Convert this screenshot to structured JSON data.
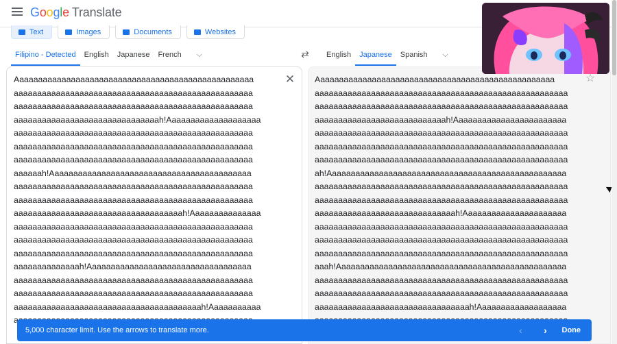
{
  "app": {
    "brand_letters": [
      "G",
      "o",
      "o",
      "g",
      "l",
      "e"
    ],
    "brand_suffix": "Translate"
  },
  "modes": [
    {
      "label": "Text",
      "icon": "translate-icon",
      "active": true
    },
    {
      "label": "Images",
      "icon": "image-icon",
      "active": false
    },
    {
      "label": "Documents",
      "icon": "document-icon",
      "active": false
    },
    {
      "label": "Websites",
      "icon": "website-icon",
      "active": false
    }
  ],
  "source_langs": [
    {
      "label": "Filipino - Detected",
      "active": true
    },
    {
      "label": "English",
      "active": false
    },
    {
      "label": "Japanese",
      "active": false
    },
    {
      "label": "French",
      "active": false
    }
  ],
  "target_langs": [
    {
      "label": "English",
      "active": false
    },
    {
      "label": "Japanese",
      "active": true
    },
    {
      "label": "Spanish",
      "active": false
    }
  ],
  "source_text": "Aaaaaaaaaaaaaaaaaaaaaaaaaaaaaaaaaaaaaaaaaaaaaaaaaaa\naaaaaaaaaaaaaaaaaaaaaaaaaaaaaaaaaaaaaaaaaaaaaaaaaaa\naaaaaaaaaaaaaaaaaaaaaaaaaaaaaaaaaaaaaaaaaaaaaaaaaaa\naaaaaaaaaaaaaaaaaaaaaaaaaaaaaaah!Aaaaaaaaaaaaaaaaaaaa\naaaaaaaaaaaaaaaaaaaaaaaaaaaaaaaaaaaaaaaaaaaaaaaaaaa\naaaaaaaaaaaaaaaaaaaaaaaaaaaaaaaaaaaaaaaaaaaaaaaaaaa\naaaaaaaaaaaaaaaaaaaaaaaaaaaaaaaaaaaaaaaaaaaaaaaaaaa\naaaaaah!Aaaaaaaaaaaaaaaaaaaaaaaaaaaaaaaaaaaaaaaaaaa\naaaaaaaaaaaaaaaaaaaaaaaaaaaaaaaaaaaaaaaaaaaaaaaaaaa\naaaaaaaaaaaaaaaaaaaaaaaaaaaaaaaaaaaaaaaaaaaaaaaaaaa\naaaaaaaaaaaaaaaaaaaaaaaaaaaaaaaaaaaah!Aaaaaaaaaaaaaaa\naaaaaaaaaaaaaaaaaaaaaaaaaaaaaaaaaaaaaaaaaaaaaaaaaaa\naaaaaaaaaaaaaaaaaaaaaaaaaaaaaaaaaaaaaaaaaaaaaaaaaaa\naaaaaaaaaaaaaaaaaaaaaaaaaaaaaaaaaaaaaaaaaaaaaaaaaaa\naaaaaaaaaaaaaah!Aaaaaaaaaaaaaaaaaaaaaaaaaaaaaaaaaaa\naaaaaaaaaaaaaaaaaaaaaaaaaaaaaaaaaaaaaaaaaaaaaaaaaaa\naaaaaaaaaaaaaaaaaaaaaaaaaaaaaaaaaaaaaaaaaaaaaaaaaaa\naaaaaaaaaaaaaaaaaaaaaaaaaaaaaaaaaaaaaaaah!Aaaaaaaaaaa\naaaaaaaaaaaaaaaaaaaaaaaaaaaaaaaaaaaaaaaaaaaaaaaaaaa",
  "target_text": "Aaaaaaaaaaaaaaaaaaaaaaaaaaaaaaaaaaaaaaaaaaaaaaaaaaa\naaaaaaaaaaaaaaaaaaaaaaaaaaaaaaaaaaaaaaaaaaaaaaaaaaaaaa\naaaaaaaaaaaaaaaaaaaaaaaaaaaaaaaaaaaaaaaaaaaaaaaaaaaaaa\naaaaaaaaaaaaaaaaaaaaaaaaaaaah!Aaaaaaaaaaaaaaaaaaaaaaaa\naaaaaaaaaaaaaaaaaaaaaaaaaaaaaaaaaaaaaaaaaaaaaaaaaaaaaa\naaaaaaaaaaaaaaaaaaaaaaaaaaaaaaaaaaaaaaaaaaaaaaaaaaaaaa\naaaaaaaaaaaaaaaaaaaaaaaaaaaaaaaaaaaaaaaaaaaaaaaaaaaaaa\nah!Aaaaaaaaaaaaaaaaaaaaaaaaaaaaaaaaaaaaaaaaaaaaaaaaaaa\naaaaaaaaaaaaaaaaaaaaaaaaaaaaaaaaaaaaaaaaaaaaaaaaaaaaaa\naaaaaaaaaaaaaaaaaaaaaaaaaaaaaaaaaaaaaaaaaaaaaaaaaaaaaa\naaaaaaaaaaaaaaaaaaaaaaaaaaaaaah!Aaaaaaaaaaaaaaaaaaaaaa\naaaaaaaaaaaaaaaaaaaaaaaaaaaaaaaaaaaaaaaaaaaaaaaaaaaaaa\naaaaaaaaaaaaaaaaaaaaaaaaaaaaaaaaaaaaaaaaaaaaaaaaaaaaaa\naaaaaaaaaaaaaaaaaaaaaaaaaaaaaaaaaaaaaaaaaaaaaaaaaaaaaa\naaah!Aaaaaaaaaaaaaaaaaaaaaaaaaaaaaaaaaaaaaaaaaaaaaaaaa\naaaaaaaaaaaaaaaaaaaaaaaaaaaaaaaaaaaaaaaaaaaaaaaaaaaaaa\naaaaaaaaaaaaaaaaaaaaaaaaaaaaaaaaaaaaaaaaaaaaaaaaaaaaaa\naaaaaaaaaaaaaaaaaaaaaaaaaaaaaaaaah!Aaaaaaaaaaaaaaaaaaa\naaaaaaaaaaaaaaaaaaaaaaaaaaaaaaaaaaaaaaaaaaaaaaaaaaaaaa",
  "snackbar": {
    "message": "5,000 character limit. Use the arrows to translate more.",
    "done_label": "Done"
  },
  "icons": {
    "menu": "menu-icon",
    "swap": "swap-languages-icon",
    "clear": "close-icon",
    "star": "star-icon",
    "more_source": "chevron-down-icon",
    "more_target": "chevron-down-icon",
    "prev": "chevron-left-icon",
    "next": "chevron-right-icon"
  },
  "colors": {
    "accent": "#1a73e8",
    "snackbar_bg": "#1a73e8",
    "target_panel_bg": "#f5f5f5"
  }
}
